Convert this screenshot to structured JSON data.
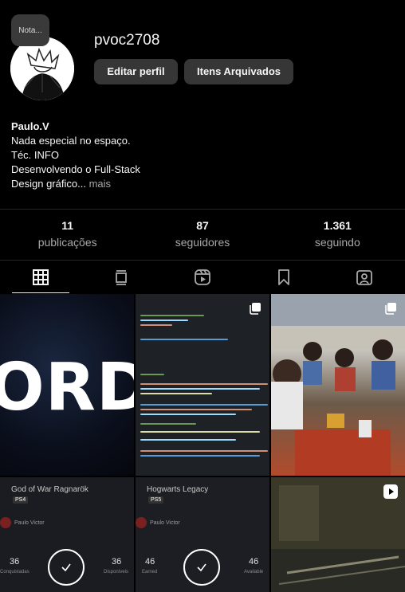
{
  "profile": {
    "note_label": "Nota...",
    "username": "pvoc2708",
    "edit_button": "Editar perfil",
    "archive_button": "Itens Arquivados"
  },
  "bio": {
    "name": "Paulo.V",
    "lines": [
      "Nada especial no espaço.",
      "Téc. INFO",
      "Desenvolvendo o Full-Stack"
    ],
    "last_line": "Design gráfico...",
    "more_label": "mais"
  },
  "stats": [
    {
      "count": "11",
      "label": "publicações"
    },
    {
      "count": "87",
      "label": "seguidores"
    },
    {
      "count": "1.361",
      "label": "seguindo"
    }
  ],
  "tabs": [
    {
      "icon": "grid-icon",
      "active": true
    },
    {
      "icon": "feed-icon",
      "active": false
    },
    {
      "icon": "reels-icon",
      "active": false
    },
    {
      "icon": "bookmark-icon",
      "active": false
    },
    {
      "icon": "tagged-icon",
      "active": false
    }
  ],
  "posts": {
    "post1": {
      "text": "ORD"
    },
    "post4": {
      "title": "God of War Ragnarök",
      "platform": "PS4",
      "user": "Paulo Victor",
      "left_count": "36",
      "left_label": "Conquistadas",
      "right_count": "36",
      "right_label": "Disponíveis"
    },
    "post5": {
      "title": "Hogwarts Legacy",
      "platform": "PS5",
      "user": "Paulo Victor",
      "left_count": "46",
      "left_label": "Earned",
      "right_count": "46",
      "right_label": "Available"
    }
  },
  "colors": {
    "background": "#000000",
    "button_bg": "#363636",
    "muted_text": "#a8a8a8"
  }
}
